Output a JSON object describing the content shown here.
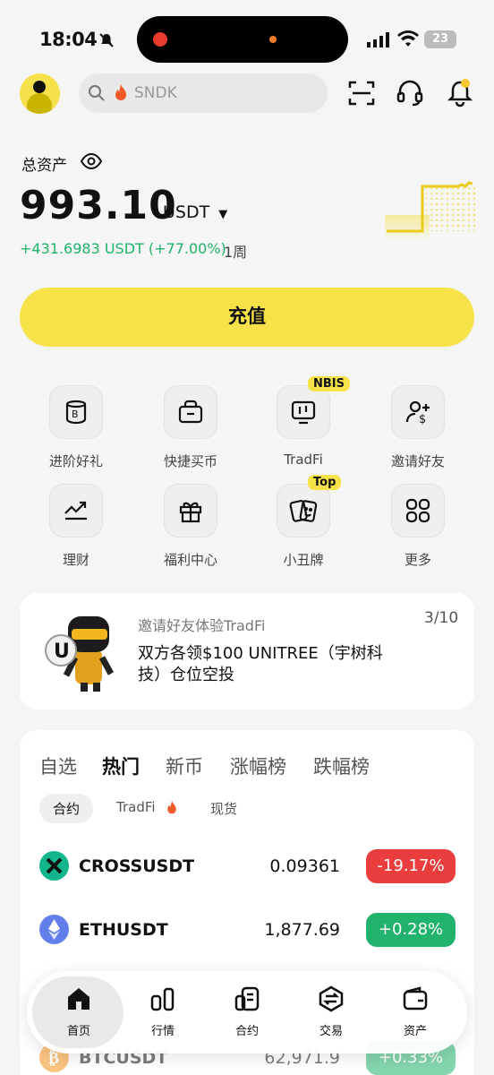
{
  "status": {
    "time": "18:04",
    "battery": "23"
  },
  "header": {
    "search_placeholder": "SNDK"
  },
  "assets": {
    "label": "总资产",
    "balance": "993.10",
    "unit": "USDT",
    "pnl": "+431.6983 USDT (+77.00%)",
    "period": "1周",
    "deposit_label": "充值"
  },
  "grid": {
    "items": [
      {
        "label": "进阶好礼",
        "icon": "gift-bucket-icon"
      },
      {
        "label": "快捷买币",
        "icon": "bag-icon"
      },
      {
        "label": "TradFi",
        "icon": "chart-monitor-icon",
        "tag": "NBIS"
      },
      {
        "label": "邀请好友",
        "icon": "invite-user-icon"
      },
      {
        "label": "理财",
        "icon": "growth-icon"
      },
      {
        "label": "福利中心",
        "icon": "gift-icon"
      },
      {
        "label": "小丑牌",
        "icon": "cards-icon",
        "tag": "Top"
      },
      {
        "label": "更多",
        "icon": "more-grid-icon"
      }
    ]
  },
  "invite_card": {
    "subtitle": "邀请好友体验TradFi",
    "page": "3/10",
    "title": "双方各领$100 UNITREE（宇树科技）仓位空投"
  },
  "market": {
    "tabs": [
      "自选",
      "热门",
      "新币",
      "涨幅榜",
      "跌幅榜"
    ],
    "active_tab": "热门",
    "subtabs": [
      "合约",
      "TradFi",
      "现货"
    ],
    "rows": [
      {
        "symbol": "CROSSUSDT",
        "price": "0.09361",
        "change": "-19.17%",
        "color": "#ea3d3d"
      },
      {
        "symbol": "ETHUSDT",
        "price": "1,877.69",
        "change": "+0.28%",
        "color": "#21b36d"
      },
      {
        "symbol": "BTCUSDT",
        "price": "62,971.9",
        "change": "+0.33%",
        "color": "#21b36d"
      }
    ]
  },
  "tabbar": [
    "首页",
    "行情",
    "合约",
    "交易",
    "资产"
  ],
  "colors": {
    "accent": "#f7e24a",
    "up": "#21b36d",
    "down": "#ea3d3d"
  }
}
